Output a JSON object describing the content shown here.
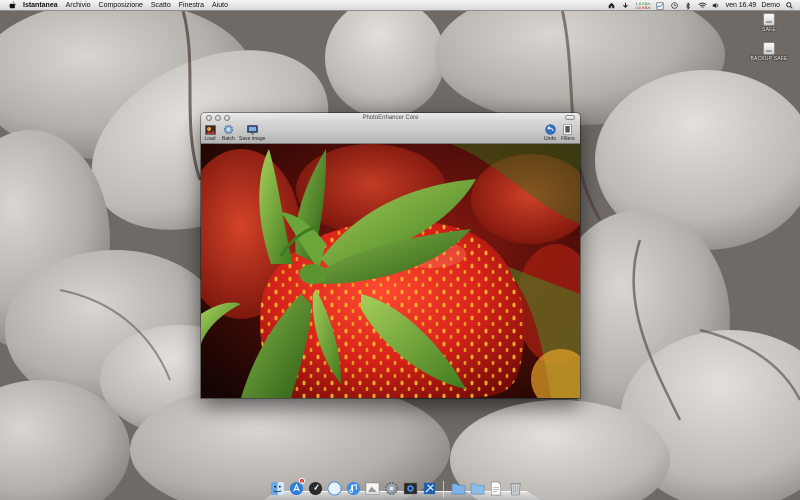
{
  "menubar": {
    "apple_icon": "apple-icon",
    "items": [
      {
        "label": "Istantanea",
        "app": true
      },
      {
        "label": "Archivio"
      },
      {
        "label": "Composizione"
      },
      {
        "label": "Scatto"
      },
      {
        "label": "Finestra"
      },
      {
        "label": "Aiuto"
      }
    ],
    "net_up": "1,8 KB/s",
    "net_down": "0,6 KB/s",
    "clock": "ven 16.49",
    "user": "Demo"
  },
  "desktop": {
    "drives": [
      {
        "label": "SAFE"
      },
      {
        "label": "BACKUP SAFE"
      }
    ]
  },
  "window": {
    "title": "PhotoEnhancer Core",
    "toolbar": {
      "load": "Load",
      "batch": "Batch",
      "save_image": "Save image",
      "undo": "Undo",
      "filters": "Filters"
    }
  },
  "dock": {
    "mail_badge": "5",
    "icons": [
      "finder-icon",
      "app-store-icon",
      "dashboard-icon",
      "safari-icon",
      "itunes-icon",
      "preview-icon",
      "system-preferences-icon",
      "photoenhancer-icon",
      "xcode-icon"
    ],
    "right_icons": [
      "applications-folder-icon",
      "documents-folder-icon",
      "text-file-icon",
      "trash-icon"
    ]
  },
  "colors": {
    "accent_blue": "#2f6fc9",
    "strawberry_red": "#d6261c",
    "leaf_green": "#5e9d2c"
  }
}
